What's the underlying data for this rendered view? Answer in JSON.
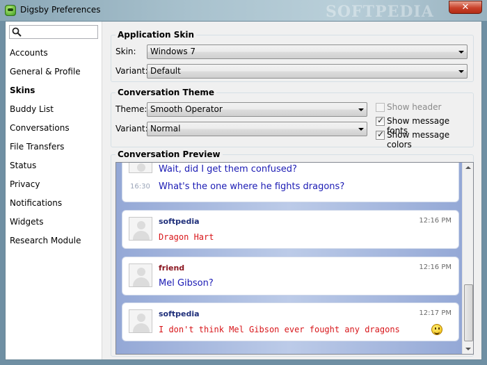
{
  "window": {
    "title": "Digsby Preferences",
    "watermark": "SOFTPEDIA",
    "close_symbol": "✕"
  },
  "sidebar": {
    "search_placeholder": "",
    "items": [
      {
        "label": "Accounts"
      },
      {
        "label": "General & Profile"
      },
      {
        "label": "Skins",
        "active": true
      },
      {
        "label": "Buddy List"
      },
      {
        "label": "Conversations"
      },
      {
        "label": "File Transfers"
      },
      {
        "label": "Status"
      },
      {
        "label": "Privacy"
      },
      {
        "label": "Notifications"
      },
      {
        "label": "Widgets"
      },
      {
        "label": "Research Module"
      }
    ]
  },
  "app_skin": {
    "title": "Application Skin",
    "skin_label": "Skin:",
    "skin_value": "Windows 7",
    "variant_label": "Variant:",
    "variant_value": "Default"
  },
  "conv_theme": {
    "title": "Conversation Theme",
    "theme_label": "Theme:",
    "theme_value": "Smooth Operator",
    "variant_label": "Variant:",
    "variant_value": "Normal",
    "show_header": {
      "label": "Show header",
      "checked": false,
      "enabled": false
    },
    "show_fonts": {
      "label": "Show message fonts",
      "checked": true
    },
    "show_colors": {
      "label": "Show message colors",
      "checked": true
    }
  },
  "preview": {
    "title": "Conversation Preview",
    "messages": [
      {
        "lines": [
          "Wait, did I get them confused?",
          "What's the one where he fights dragons?"
        ],
        "time2": "16:30"
      },
      {
        "sender": "softpedia",
        "time": "12:16 PM",
        "text": "Dragon Hart"
      },
      {
        "sender": "friend",
        "time": "12:16 PM",
        "text": "Mel Gibson?"
      },
      {
        "sender": "softpedia",
        "time": "12:17 PM",
        "text": "I don't think Mel Gibson ever fought any dragons"
      }
    ]
  },
  "colors": {
    "sender_self": "#1f2f7a",
    "sender_friend": "#8b1620",
    "text_blue": "#1a1ab4",
    "text_red": "#d8161a"
  }
}
